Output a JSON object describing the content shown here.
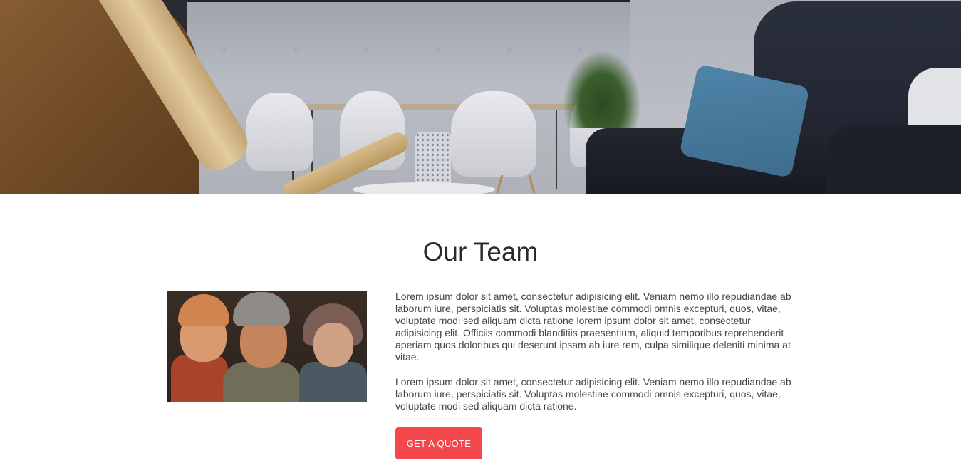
{
  "hero": {
    "alt": "Office lounge interior"
  },
  "team_section": {
    "title": "Our Team",
    "photo_alt": "Team photo",
    "paragraphs": [
      "Lorem ipsum dolor sit amet, consectetur adipisicing elit. Veniam nemo illo repudiandae ab laborum iure, perspiciatis sit. Voluptas molestiae commodi omnis excepturi, quos, vitae, voluptate modi sed aliquam dicta ratione lorem ipsum dolor sit amet, consectetur adipisicing elit. Officiis commodi blanditiis praesentium, aliquid temporibus reprehenderit aperiam quos doloribus qui deserunt ipsam ab iure rem, culpa similique deleniti minima at vitae.",
      "Lorem ipsum dolor sit amet, consectetur adipisicing elit. Veniam nemo illo repudiandae ab laborum iure, perspiciatis sit. Voluptas molestiae commodi omnis excepturi, quos, vitae, voluptate modi sed aliquam dicta ratione."
    ],
    "cta_label": "GET A QUOTE"
  },
  "colors": {
    "accent": "#f2474b",
    "heading": "#2b2b2b",
    "body_text": "#444444"
  }
}
